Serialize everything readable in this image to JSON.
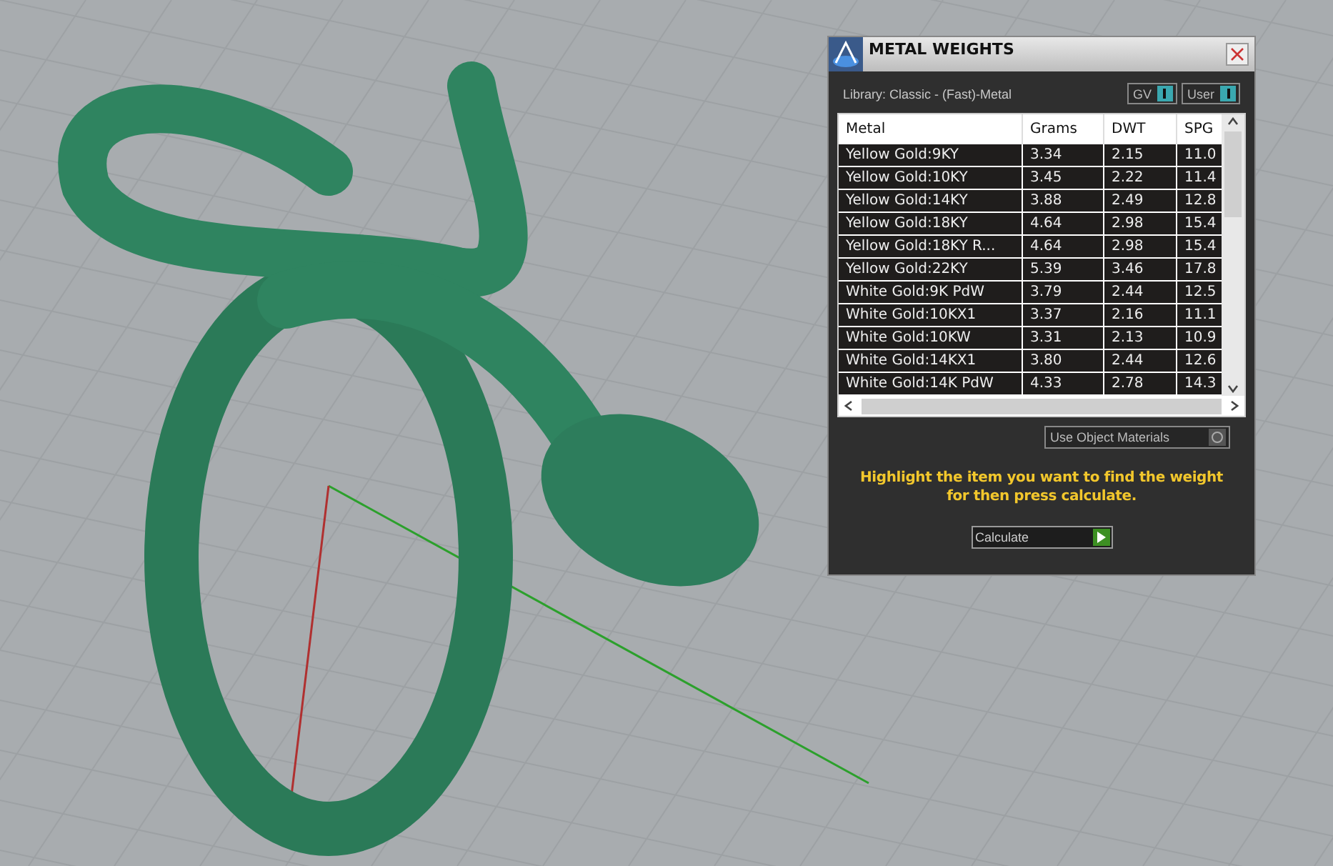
{
  "panel": {
    "title": "METAL WEIGHTS",
    "library": "Library: Classic - (Fast)-Metal",
    "toggles": [
      {
        "label": "GV",
        "on": true
      },
      {
        "label": "User",
        "on": true
      }
    ],
    "table": {
      "columns": [
        "Metal",
        "Grams",
        "DWT",
        "SPG"
      ],
      "rows": [
        [
          "Yellow Gold:9KY",
          "3.34",
          "2.15",
          "11.0"
        ],
        [
          "Yellow Gold:10KY",
          "3.45",
          "2.22",
          "11.4"
        ],
        [
          "Yellow Gold:14KY",
          "3.88",
          "2.49",
          "12.8"
        ],
        [
          "Yellow Gold:18KY",
          "4.64",
          "2.98",
          "15.4"
        ],
        [
          "Yellow Gold:18KY R...",
          "4.64",
          "2.98",
          "15.4"
        ],
        [
          "Yellow Gold:22KY",
          "5.39",
          "3.46",
          "17.8"
        ],
        [
          "White Gold:9K PdW",
          "3.79",
          "2.44",
          "12.5"
        ],
        [
          "White Gold:10KX1",
          "3.37",
          "2.16",
          "11.1"
        ],
        [
          "White Gold:10KW",
          "3.31",
          "2.13",
          "10.9"
        ],
        [
          "White Gold:14KX1",
          "3.80",
          "2.44",
          "12.6"
        ],
        [
          "White Gold:14K PdW",
          "4.33",
          "2.78",
          "14.3"
        ]
      ]
    },
    "use_object_materials": {
      "label": "Use Object Materials",
      "on": false
    },
    "hint": "Highlight the item you want to find the weight for then press calculate.",
    "calculate_button": "Calculate"
  }
}
